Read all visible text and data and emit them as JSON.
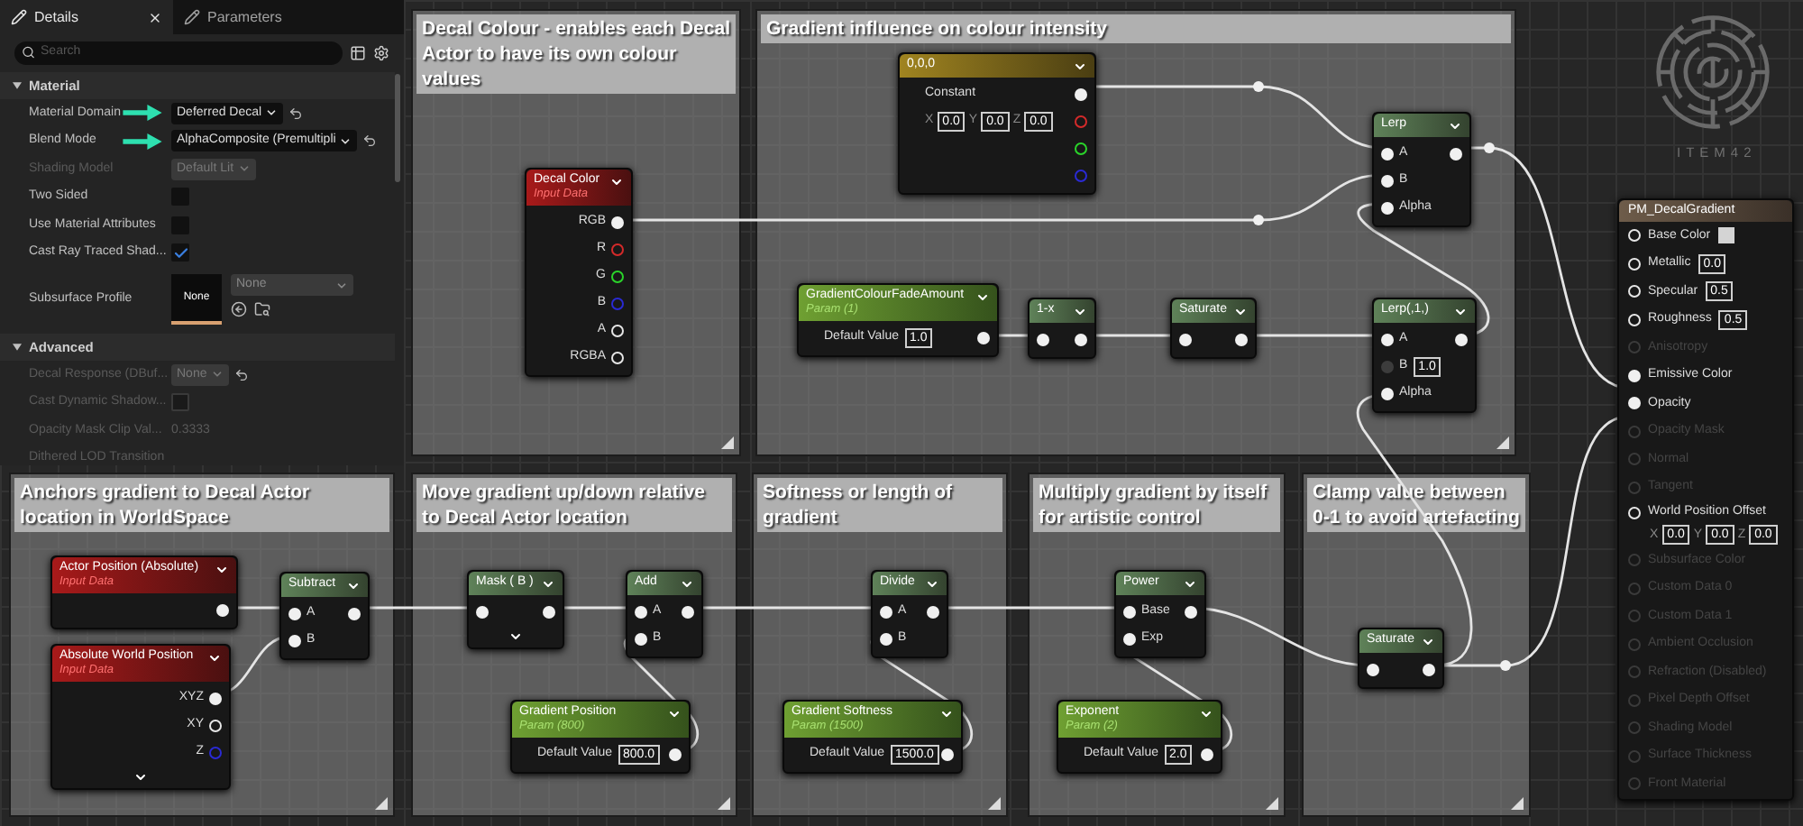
{
  "details_panel": {
    "tabs": [
      {
        "label": "Details",
        "selected": true
      },
      {
        "label": "Parameters",
        "selected": false
      }
    ],
    "search": {
      "placeholder": "Search"
    },
    "sections": [
      {
        "title": "Material",
        "expanded": true,
        "rows": [
          {
            "kind": "dropdown",
            "label": "Material Domain",
            "value": "Deferred Decal",
            "disabled": false,
            "annotated": true,
            "resettable": true
          },
          {
            "kind": "dropdown",
            "label": "Blend Mode",
            "value": "AlphaComposite (Premultipli",
            "disabled": false,
            "annotated": true,
            "resettable": true
          },
          {
            "kind": "dropdown",
            "label": "Shading Model",
            "value": "Default Lit",
            "disabled": true,
            "annotated": false,
            "resettable": false
          },
          {
            "kind": "checkbox",
            "label": "Two Sided",
            "checked": false,
            "disabled": false
          },
          {
            "kind": "checkbox",
            "label": "Use Material Attributes",
            "checked": false,
            "disabled": false
          },
          {
            "kind": "checkbox",
            "label": "Cast Ray Traced Shad...",
            "checked": true,
            "disabled": false
          },
          {
            "kind": "asset",
            "label": "Subsurface Profile",
            "thumbnail": "None",
            "value": "None",
            "disabled": false
          }
        ]
      },
      {
        "title": "Advanced",
        "expanded": true,
        "rows": [
          {
            "kind": "dropdown",
            "label": "Decal Response (DBuf...",
            "value": "None",
            "disabled": true,
            "annotated": false,
            "resettable": true
          },
          {
            "kind": "checkbox",
            "label": "Cast Dynamic Shadow...",
            "checked": false,
            "disabled": true
          },
          {
            "kind": "text",
            "label": "Opacity Mask Clip Val...",
            "value": "0.3333",
            "disabled": true
          },
          {
            "kind": "label",
            "label": "Dithered LOD Transition",
            "disabled": true
          }
        ]
      }
    ]
  },
  "graph": {
    "comments": [
      {
        "title": "Decal Colour - enables each Decal Actor to have its own colour values"
      },
      {
        "title": "Gradient influence on colour intensity"
      },
      {
        "title": "Anchors gradient to Decal Actor location in WorldSpace"
      },
      {
        "title": "Move gradient up/down relative to Decal Actor location"
      },
      {
        "title": "Softness or length of gradient"
      },
      {
        "title": "Multiply gradient by itself for artistic control"
      },
      {
        "title": "Clamp value between 0-1 to avoid artefacting"
      }
    ],
    "nodes": [
      {
        "kind": "input",
        "title": "Decal Color",
        "subtitle": "Input Data",
        "outputs": [
          {
            "label": "RGB",
            "connected": true
          },
          {
            "label": "R",
            "connected": false,
            "color": "#d42a2a"
          },
          {
            "label": "G",
            "connected": false,
            "color": "#2ad42a"
          },
          {
            "label": "B",
            "connected": false,
            "color": "#2a2ad4"
          },
          {
            "label": "A",
            "connected": false
          },
          {
            "label": "RGBA",
            "connected": false
          }
        ]
      },
      {
        "kind": "constant",
        "title": "0,0,0",
        "label": "Constant",
        "fields": [
          {
            "axis": "X",
            "value": "0.0"
          },
          {
            "axis": "Y",
            "value": "0.0"
          },
          {
            "axis": "Z",
            "value": "0.0"
          }
        ],
        "outputs": [
          {
            "connected": true
          },
          {
            "connected": false,
            "color": "#d42a2a"
          },
          {
            "connected": false,
            "color": "#2ad42a"
          },
          {
            "connected": false,
            "color": "#2a2ad4"
          }
        ]
      },
      {
        "kind": "param",
        "title": "GradientColourFadeAmount",
        "subtitle": "Param (1)",
        "default_value": {
          "label": "Default Value",
          "value": "1.0"
        },
        "outputs": [
          {
            "connected": true
          }
        ]
      },
      {
        "kind": "math",
        "title": "1-x",
        "inputs": [
          {
            "connected": true
          }
        ],
        "outputs": [
          {
            "connected": true
          }
        ]
      },
      {
        "kind": "math",
        "title": "Saturate",
        "inputs": [
          {
            "connected": true
          }
        ],
        "outputs": [
          {
            "connected": true
          }
        ]
      },
      {
        "kind": "math",
        "title": "Lerp",
        "inputs": [
          {
            "label": "A",
            "connected": true
          },
          {
            "label": "B",
            "connected": true
          },
          {
            "label": "Alpha",
            "connected": true
          }
        ],
        "outputs": [
          {
            "connected": true
          }
        ]
      },
      {
        "kind": "math",
        "title": "Lerp(,1,)",
        "inputs": [
          {
            "label": "A",
            "connected": true
          },
          {
            "label": "B",
            "connected": false,
            "value": "1.0"
          },
          {
            "label": "Alpha",
            "connected": true
          }
        ],
        "outputs": [
          {
            "connected": true
          }
        ]
      },
      {
        "kind": "input",
        "title": "Actor Position (Absolute)",
        "subtitle": "Input Data",
        "outputs": [
          {
            "connected": true
          }
        ]
      },
      {
        "kind": "input",
        "title": "Absolute World Position",
        "subtitle": "Input Data",
        "more_pins": true,
        "outputs": [
          {
            "label": "XYZ",
            "connected": true
          },
          {
            "label": "XY",
            "connected": false
          },
          {
            "label": "Z",
            "connected": false,
            "color": "#2a2ad4"
          }
        ]
      },
      {
        "kind": "math",
        "title": "Subtract",
        "inputs": [
          {
            "label": "A",
            "connected": true
          },
          {
            "label": "B",
            "connected": true
          }
        ],
        "outputs": [
          {
            "connected": true
          }
        ]
      },
      {
        "kind": "math",
        "title": "Mask ( B )",
        "more_pins": true,
        "inputs": [
          {
            "connected": true
          }
        ],
        "outputs": [
          {
            "connected": true
          }
        ]
      },
      {
        "kind": "math",
        "title": "Add",
        "inputs": [
          {
            "label": "A",
            "connected": true
          },
          {
            "label": "B",
            "connected": true
          }
        ],
        "outputs": [
          {
            "connected": true
          }
        ]
      },
      {
        "kind": "param",
        "title": "Gradient Position",
        "subtitle": "Param (800)",
        "default_value": {
          "label": "Default Value",
          "value": "800.0"
        },
        "outputs": [
          {
            "connected": true
          }
        ]
      },
      {
        "kind": "math",
        "title": "Divide",
        "inputs": [
          {
            "label": "A",
            "connected": true
          },
          {
            "label": "B",
            "connected": true
          }
        ],
        "outputs": [
          {
            "connected": true
          }
        ]
      },
      {
        "kind": "param",
        "title": "Gradient Softness",
        "subtitle": "Param (1500)",
        "default_value": {
          "label": "Default Value",
          "value": "1500.0"
        },
        "outputs": [
          {
            "connected": true
          }
        ]
      },
      {
        "kind": "math",
        "title": "Power",
        "inputs": [
          {
            "label": "Base",
            "connected": true
          },
          {
            "label": "Exp",
            "connected": true
          }
        ],
        "outputs": [
          {
            "connected": true
          }
        ]
      },
      {
        "kind": "param",
        "title": "Exponent",
        "subtitle": "Param (2)",
        "default_value": {
          "label": "Default Value",
          "value": "2.0"
        },
        "outputs": [
          {
            "connected": true
          }
        ]
      },
      {
        "kind": "math",
        "title": "Saturate",
        "inputs": [
          {
            "connected": true
          }
        ],
        "outputs": [
          {
            "connected": true
          }
        ]
      }
    ],
    "result_node": {
      "title": "PM_DecalGradient",
      "inputs": [
        {
          "kind": "color",
          "label": "Base Color",
          "connected": false,
          "disabled": false
        },
        {
          "kind": "scalar",
          "label": "Metallic",
          "value": "0.0",
          "connected": false,
          "disabled": false
        },
        {
          "kind": "scalar",
          "label": "Specular",
          "value": "0.5",
          "connected": false,
          "disabled": false
        },
        {
          "kind": "scalar",
          "label": "Roughness",
          "value": "0.5",
          "connected": false,
          "disabled": false
        },
        {
          "kind": "plain",
          "label": "Anisotropy",
          "connected": false,
          "disabled": true
        },
        {
          "kind": "plain",
          "label": "Emissive Color",
          "connected": true,
          "disabled": false
        },
        {
          "kind": "plain",
          "label": "Opacity",
          "connected": true,
          "disabled": false
        },
        {
          "kind": "plain",
          "label": "Opacity Mask",
          "connected": false,
          "disabled": true
        },
        {
          "kind": "plain",
          "label": "Normal",
          "connected": false,
          "disabled": true
        },
        {
          "kind": "plain",
          "label": "Tangent",
          "connected": false,
          "disabled": true
        },
        {
          "kind": "vector",
          "label": "World Position Offset",
          "fields": [
            {
              "axis": "X",
              "value": "0.0"
            },
            {
              "axis": "Y",
              "value": "0.0"
            },
            {
              "axis": "Z",
              "value": "0.0"
            }
          ],
          "connected": false,
          "disabled": false
        },
        {
          "kind": "plain",
          "label": "Subsurface Color",
          "connected": false,
          "disabled": true
        },
        {
          "kind": "plain",
          "label": "Custom Data 0",
          "connected": false,
          "disabled": true
        },
        {
          "kind": "plain",
          "label": "Custom Data 1",
          "connected": false,
          "disabled": true
        },
        {
          "kind": "plain",
          "label": "Ambient Occlusion",
          "connected": false,
          "disabled": true
        },
        {
          "kind": "plain",
          "label": "Refraction (Disabled)",
          "connected": false,
          "disabled": true
        },
        {
          "kind": "plain",
          "label": "Pixel Depth Offset",
          "connected": false,
          "disabled": true
        },
        {
          "kind": "plain",
          "label": "Shading Model",
          "connected": false,
          "disabled": true
        },
        {
          "kind": "plain",
          "label": "Surface Thickness",
          "connected": false,
          "disabled": true
        },
        {
          "kind": "plain",
          "label": "Front Material",
          "connected": false,
          "disabled": true
        }
      ]
    }
  },
  "logo": {
    "text": "ITEM42"
  }
}
